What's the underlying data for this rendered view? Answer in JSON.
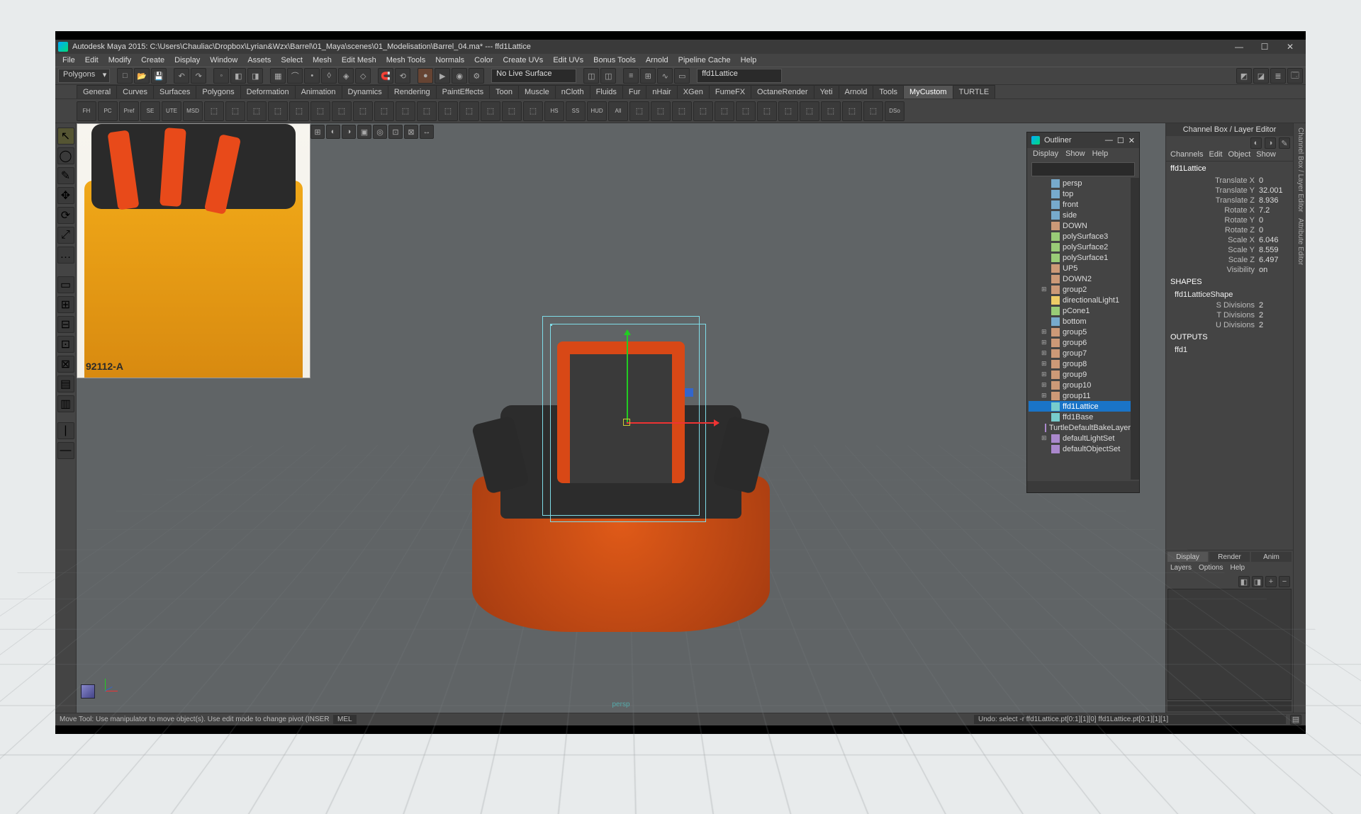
{
  "title": "Autodesk Maya 2015: C:\\Users\\Chauliac\\Dropbox\\Lyrian&Wzx\\Barrel\\01_Maya\\scenes\\01_Modelisation\\Barrel_04.ma* --- ffd1Lattice",
  "menus": [
    "File",
    "Edit",
    "Modify",
    "Create",
    "Display",
    "Window",
    "Assets",
    "Select",
    "Mesh",
    "Edit Mesh",
    "Mesh Tools",
    "Normals",
    "Color",
    "Create UVs",
    "Edit UVs",
    "Bonus Tools",
    "Arnold",
    "Pipeline Cache",
    "Help"
  ],
  "mode_dropdown": "Polygons",
  "status_surface": "No Live Surface",
  "selection_field": "ffd1Lattice",
  "shelf_tabs": [
    "General",
    "Curves",
    "Surfaces",
    "Polygons",
    "Deformation",
    "Animation",
    "Dynamics",
    "Rendering",
    "PaintEffects",
    "Toon",
    "Muscle",
    "nCloth",
    "Fluids",
    "Fur",
    "nHair",
    "XGen",
    "FumeFX",
    "OctaneRender",
    "Yeti",
    "Arnold",
    "Tools",
    "MyCustom",
    "TURTLE"
  ],
  "active_shelf": "MyCustom",
  "shelf_items": [
    "FH",
    "PC",
    "Pref",
    "SE",
    "UTE",
    "MSD",
    "",
    "",
    "",
    "",
    "",
    "",
    "",
    "",
    "",
    "",
    "",
    "",
    "",
    "",
    "",
    "",
    "HS",
    "SS",
    "HUD",
    "All",
    "",
    "",
    "",
    "",
    "",
    "",
    "",
    "",
    "",
    "",
    "",
    "",
    "DSo"
  ],
  "ref_label": "92112-A",
  "outliner": {
    "title": "Outliner",
    "menus": [
      "Display",
      "Show",
      "Help"
    ],
    "items": [
      {
        "t": "persp",
        "exp": "",
        "ic": "cam"
      },
      {
        "t": "top",
        "exp": "",
        "ic": "cam"
      },
      {
        "t": "front",
        "exp": "",
        "ic": "cam"
      },
      {
        "t": "side",
        "exp": "",
        "ic": "cam"
      },
      {
        "t": "DOWN",
        "exp": "",
        "ic": "grp"
      },
      {
        "t": "polySurface3",
        "exp": "",
        "ic": "mesh"
      },
      {
        "t": "polySurface2",
        "exp": "",
        "ic": "mesh"
      },
      {
        "t": "polySurface1",
        "exp": "",
        "ic": "mesh"
      },
      {
        "t": "UP5",
        "exp": "",
        "ic": "grp"
      },
      {
        "t": "DOWN2",
        "exp": "",
        "ic": "grp"
      },
      {
        "t": "group2",
        "exp": "+",
        "ic": "grp"
      },
      {
        "t": "directionalLight1",
        "exp": "",
        "ic": "light"
      },
      {
        "t": "pCone1",
        "exp": "",
        "ic": "mesh"
      },
      {
        "t": "bottom",
        "exp": "",
        "ic": "cam"
      },
      {
        "t": "group5",
        "exp": "+",
        "ic": "grp"
      },
      {
        "t": "group6",
        "exp": "+",
        "ic": "grp"
      },
      {
        "t": "group7",
        "exp": "+",
        "ic": "grp"
      },
      {
        "t": "group8",
        "exp": "+",
        "ic": "grp"
      },
      {
        "t": "group9",
        "exp": "+",
        "ic": "grp"
      },
      {
        "t": "group10",
        "exp": "+",
        "ic": "grp"
      },
      {
        "t": "group11",
        "exp": "+",
        "ic": "grp"
      },
      {
        "t": "ffd1Lattice",
        "exp": "",
        "ic": "lat",
        "sel": true
      },
      {
        "t": "ffd1Base",
        "exp": "",
        "ic": "lat"
      },
      {
        "t": "TurtleDefaultBakeLayer",
        "exp": "",
        "ic": "set"
      },
      {
        "t": "defaultLightSet",
        "exp": "+",
        "ic": "set"
      },
      {
        "t": "defaultObjectSet",
        "exp": "",
        "ic": "set"
      }
    ]
  },
  "channelbox": {
    "title": "Channel Box / Layer Editor",
    "tabs": [
      "Channels",
      "Edit",
      "Object",
      "Show"
    ],
    "object": "ffd1Lattice",
    "attrs": [
      {
        "l": "Translate X",
        "v": "0"
      },
      {
        "l": "Translate Y",
        "v": "32.001"
      },
      {
        "l": "Translate Z",
        "v": "8.936"
      },
      {
        "l": "Rotate X",
        "v": "7.2"
      },
      {
        "l": "Rotate Y",
        "v": "0"
      },
      {
        "l": "Rotate Z",
        "v": "0"
      },
      {
        "l": "Scale X",
        "v": "6.046"
      },
      {
        "l": "Scale Y",
        "v": "8.559"
      },
      {
        "l": "Scale Z",
        "v": "6.497"
      },
      {
        "l": "Visibility",
        "v": "on"
      }
    ],
    "shapes_label": "SHAPES",
    "shape": "ffd1LatticeShape",
    "shape_attrs": [
      {
        "l": "S Divisions",
        "v": "2"
      },
      {
        "l": "T Divisions",
        "v": "2"
      },
      {
        "l": "U Divisions",
        "v": "2"
      }
    ],
    "outputs_label": "OUTPUTS",
    "output": "ffd1"
  },
  "layer_tabs": [
    "Display",
    "Render",
    "Anim"
  ],
  "layer_menu": [
    "Layers",
    "Options",
    "Help"
  ],
  "right_tabs": [
    "Channel Box / Layer Editor",
    "Attribute Editor"
  ],
  "viewport_label": "persp",
  "status_hint": "Move Tool: Use manipulator to move object(s). Use edit mode to change pivot (INSERT). Ctrl+LMB to move perp",
  "status_lang": "MEL",
  "status_result": "Undo: select -r ffd1Lattice.pt[0:1][1][0] ffd1Lattice.pt[0:1][1][1]"
}
